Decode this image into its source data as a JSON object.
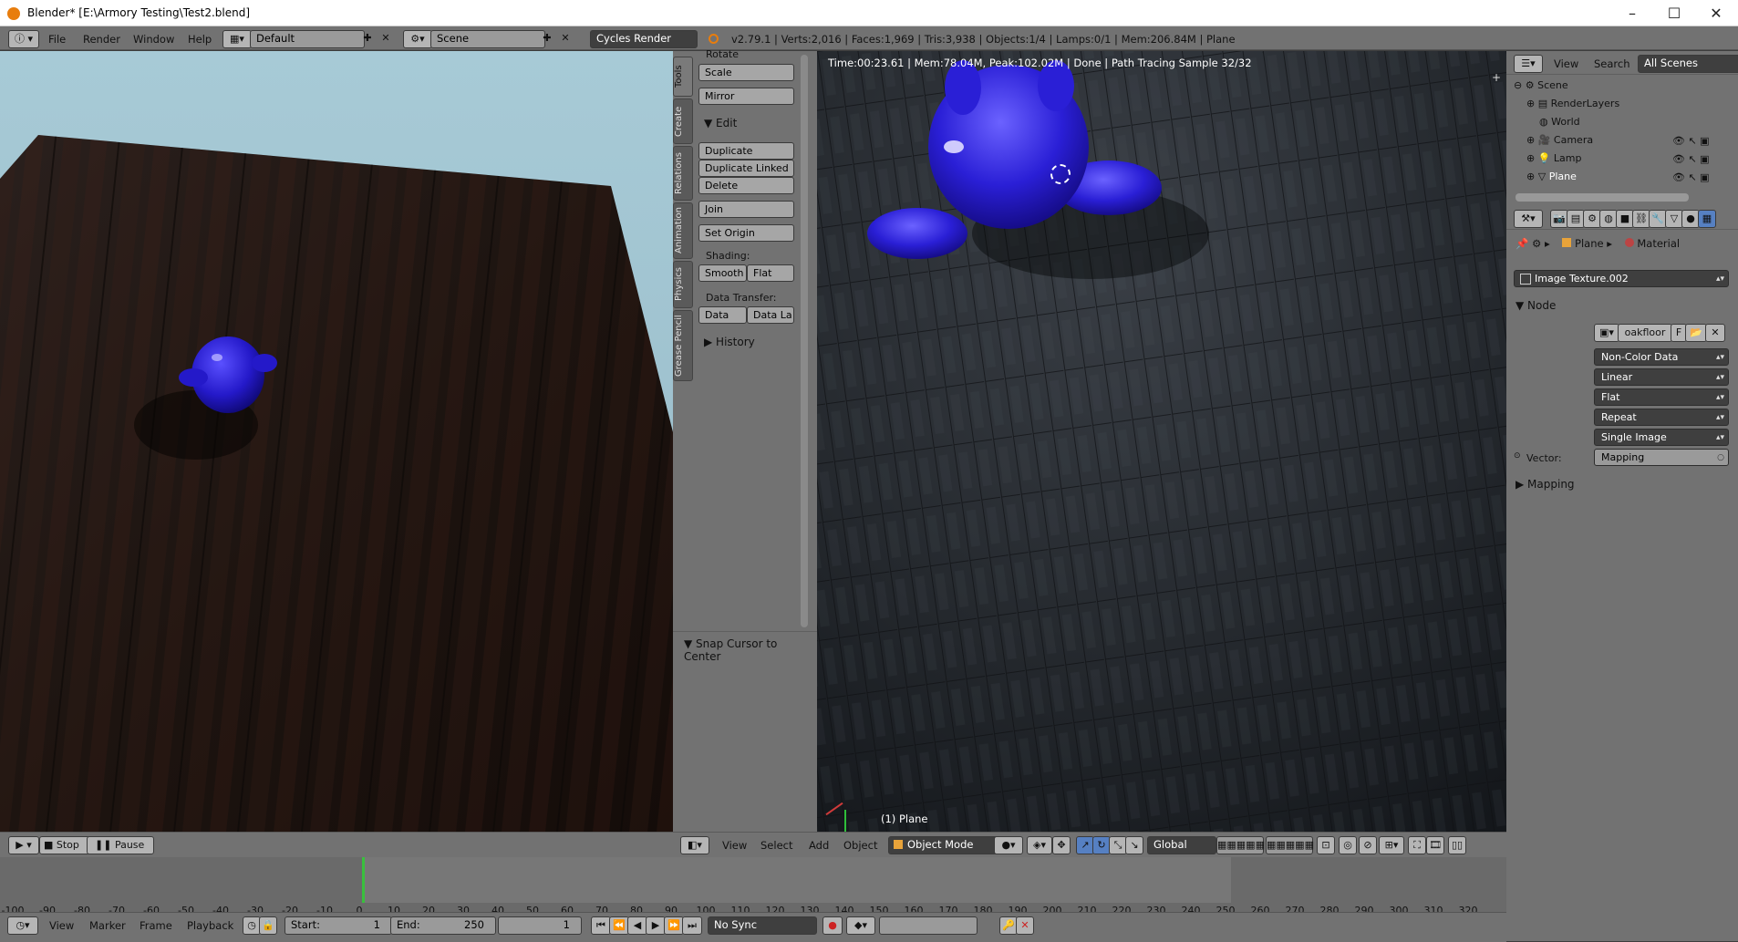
{
  "window": {
    "title": "Blender* [E:\\Armory Testing\\Test2.blend]",
    "minimize": "–",
    "maximize": "☐",
    "close": "✕"
  },
  "info_header": {
    "menus": [
      "File",
      "Render",
      "Window",
      "Help"
    ],
    "screen_layout": "Default",
    "scene": "Scene",
    "render_engine": "Cycles Render",
    "stats": "v2.79.1 | Verts:2,016 | Faces:1,969 | Tris:3,938 | Objects:1/4 | Lamps:0/1 | Mem:206.84M | Plane"
  },
  "render_view": {
    "stop_label": "Stop",
    "pause_label": "Pause"
  },
  "tool_shelf": {
    "tabs": [
      "Tools",
      "Create",
      "Relations",
      "Animation",
      "Physics",
      "Grease Pencil"
    ],
    "rotate": "Rotate",
    "scale": "Scale",
    "mirror": "Mirror",
    "edit_header": "Edit",
    "duplicate": "Duplicate",
    "duplicate_linked": "Duplicate Linked",
    "delete": "Delete",
    "join": "Join",
    "set_origin": "Set Origin",
    "shading_label": "Shading:",
    "smooth": "Smooth",
    "flat": "Flat",
    "data_transfer_label": "Data Transfer:",
    "data": "Data",
    "data_layers": "Data La",
    "history_header": "History",
    "operator_panel": "Snap Cursor to Center"
  },
  "viewport": {
    "render_info": "Time:00:23.61 | Mem:78.04M, Peak:102.02M | Done | Path Tracing Sample 32/32",
    "object_label": "(1) Plane",
    "header": {
      "menus": [
        "View",
        "Select",
        "Add",
        "Object"
      ],
      "mode": "Object Mode",
      "orientation": "Global"
    }
  },
  "outliner": {
    "menus": [
      "View",
      "Search"
    ],
    "filter": "All Scenes",
    "items": [
      {
        "name": "Scene"
      },
      {
        "name": "RenderLayers"
      },
      {
        "name": "World"
      },
      {
        "name": "Camera"
      },
      {
        "name": "Lamp"
      },
      {
        "name": "Plane"
      }
    ]
  },
  "properties": {
    "breadcrumb": {
      "object": "Plane",
      "tab": "Material"
    },
    "node_selector": "Image Texture.002",
    "node_panel": "Node",
    "image_name": "oakfloor",
    "image_fake": "F",
    "color_space": "Non-Color Data",
    "interpolation": "Linear",
    "projection": "Flat",
    "extension": "Repeat",
    "source": "Single Image",
    "vector_label": "Vector:",
    "vector_value": "Mapping",
    "mapping_panel": "Mapping"
  },
  "timeline": {
    "ticks": [
      "-100",
      "-90",
      "-80",
      "-70",
      "-60",
      "-50",
      "-40",
      "-30",
      "-20",
      "-10",
      "0",
      "10",
      "20",
      "30",
      "40",
      "50",
      "60",
      "70",
      "80",
      "90",
      "100",
      "110",
      "120",
      "130",
      "140",
      "150",
      "160",
      "170",
      "180",
      "190",
      "200",
      "210",
      "220",
      "230",
      "240",
      "250",
      "260",
      "270",
      "280",
      "290",
      "300",
      "310",
      "320"
    ],
    "menus": [
      "View",
      "Marker",
      "Frame",
      "Playback"
    ],
    "start_label": "Start:",
    "start_value": "1",
    "end_label": "End:",
    "end_value": "250",
    "current_frame": "1",
    "sync": "No Sync"
  },
  "colors": {
    "ui_grey": "#727272",
    "active_blue": "#5680c2",
    "playhead": "#39c03d",
    "suzanne_blue": "#2a1fd6"
  }
}
